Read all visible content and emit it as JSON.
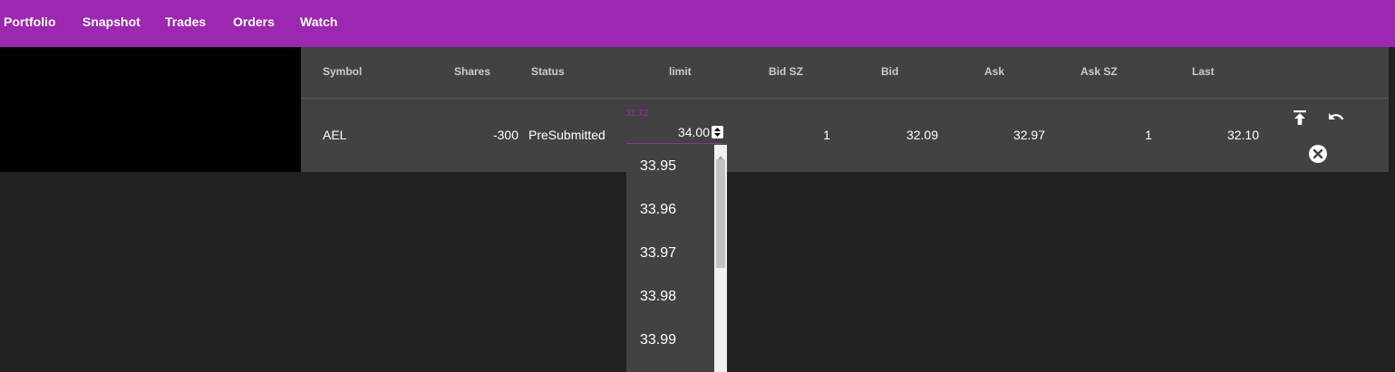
{
  "nav": {
    "items": [
      "Portfolio",
      "Snapshot",
      "Trades",
      "Orders",
      "Watch"
    ]
  },
  "table": {
    "headers": {
      "symbol": "Symbol",
      "shares": "Shares",
      "status": "Status",
      "limit": "limit",
      "bid_sz": "Bid SZ",
      "bid": "Bid",
      "ask": "Ask",
      "ask_sz": "Ask SZ",
      "last": "Last"
    },
    "row": {
      "symbol": "AEL",
      "shares": "-300",
      "status": "PreSubmitted",
      "limit_float_label": "31.72",
      "limit_value": "34.00",
      "bid_sz": "1",
      "bid": "32.09",
      "ask": "32.97",
      "ask_sz": "1",
      "last": "32.10"
    },
    "actions": [
      "upload-icon",
      "undo-icon",
      "close-circle-icon"
    ]
  },
  "dropdown": {
    "options": [
      "33.95",
      "33.96",
      "33.97",
      "33.98",
      "33.99"
    ]
  },
  "colors": {
    "primary": "#9c27b0",
    "background": "#212121",
    "surface": "#424242"
  }
}
